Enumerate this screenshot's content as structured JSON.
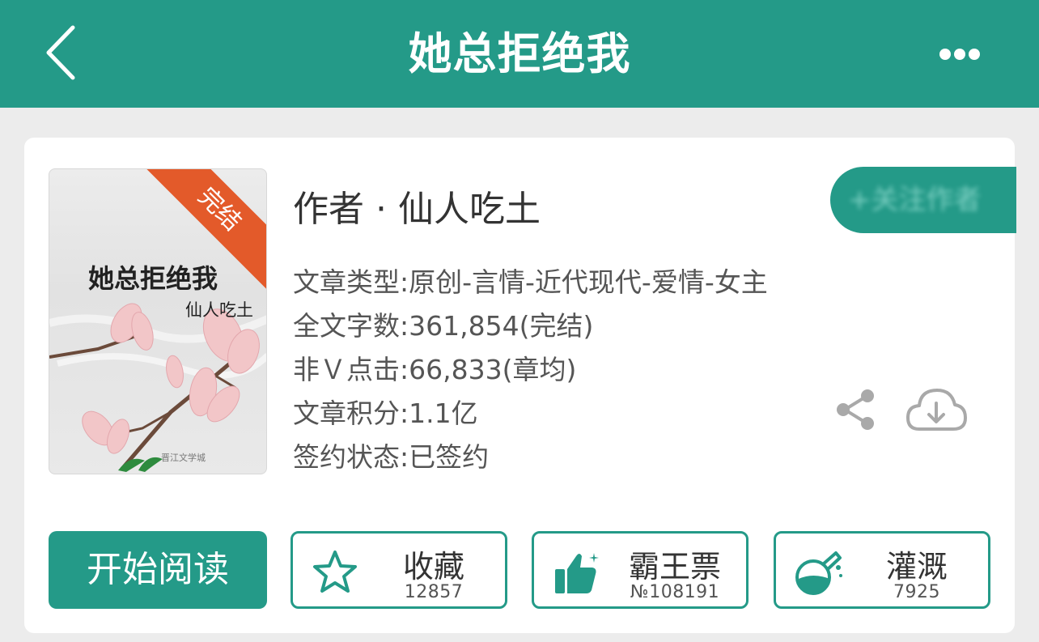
{
  "header": {
    "title": "她总拒绝我"
  },
  "book": {
    "cover_badge": "完结",
    "cover_title": "她总拒绝我",
    "cover_author": "仙人吃土",
    "author_line": "作者 · 仙人吃土",
    "meta": [
      "文章类型:原创-言情-近代现代-爱情-女主",
      "全文字数:361,854(完结)",
      "非Ｖ点击:66,833(章均)",
      "文章积分:1.1亿",
      "签约状态:已签约"
    ],
    "blurred_button_label": "+关注作者"
  },
  "actions": {
    "read_label": "开始阅读",
    "collect": {
      "label": "收藏",
      "count": "12857",
      "icon": "star-icon"
    },
    "vote": {
      "label": "霸王票",
      "count": "№108191",
      "icon": "thumbs-up-icon"
    },
    "water": {
      "label": "灌溉",
      "count": "7925",
      "icon": "flask-icon"
    }
  },
  "colors": {
    "accent": "#249a88",
    "badge": "#e35a2a",
    "background": "#ececec"
  }
}
